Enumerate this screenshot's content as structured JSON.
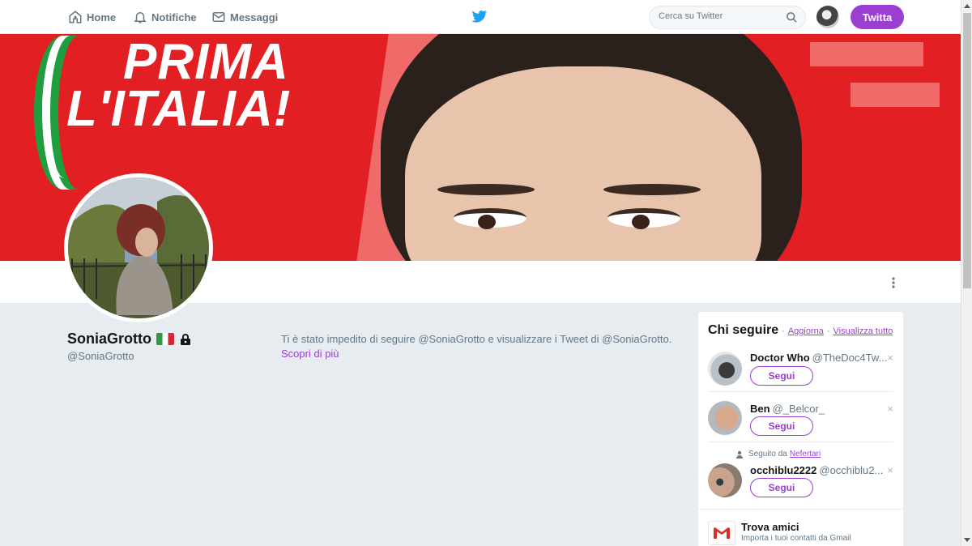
{
  "nav": {
    "home_label": "Home",
    "notifications_label": "Notifiche",
    "messages_label": "Messaggi",
    "search_placeholder": "Cerca su Twitter",
    "tweet_button_label": "Twitta"
  },
  "banner": {
    "slogan_line1": "PRIMA",
    "slogan_line2": "L'ITALIA!"
  },
  "profile": {
    "name": "SoniaGrotto",
    "handle": "@SoniaGrotto",
    "blocked_text": "Ti è stato impedito di seguire @SoniaGrotto e visualizzare i Tweet di @SoniaGrotto.",
    "learn_more": "Scopri di più"
  },
  "who_to_follow": {
    "title": "Chi seguire",
    "refresh": "Aggiorna",
    "view_all": "Visualizza tutto",
    "separator": "·",
    "follow_label": "Segui",
    "suggestions": [
      {
        "name": "Doctor Who",
        "handle": "@TheDoc4Tw..."
      },
      {
        "name": "Ben",
        "handle": "@_Belcor_"
      },
      {
        "name": "occhiblu2222",
        "handle": "@occhiblu2...",
        "followed_by_prefix": "Seguito da",
        "followed_by_name": "Nefertari"
      }
    ],
    "find_friends_title": "Trova amici",
    "find_friends_sub": "Importa i tuoi contatti da Gmail"
  },
  "colors": {
    "accent": "#9b3fd1",
    "banner_red": "#e21f22",
    "background": "#e6ecf0"
  }
}
